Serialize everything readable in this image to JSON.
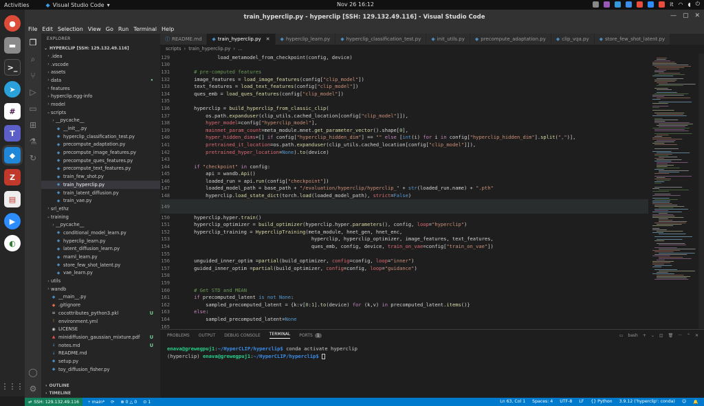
{
  "topbar": {
    "activities": "Activities",
    "app_name": "Visual Studio Code",
    "clock": "Nov 26  16:12",
    "lang": "it"
  },
  "window": {
    "title": "train_hyperclip.py - hyperclip [SSH: 129.132.49.116] - Visual Studio Code"
  },
  "menu": [
    "File",
    "Edit",
    "Selection",
    "View",
    "Go",
    "Run",
    "Terminal",
    "Help"
  ],
  "explorer": {
    "header": "EXPLORER",
    "project": "HYPERCLIP [SSH: 129.132.49.116]",
    "outline": "OUTLINE",
    "timeline": "TIMELINE",
    "items": [
      {
        "label": ".idea",
        "kind": "folder",
        "depth": 1
      },
      {
        "label": ".vscode",
        "kind": "folder",
        "depth": 1
      },
      {
        "label": "assets",
        "kind": "folder",
        "depth": 1
      },
      {
        "label": "data",
        "kind": "folder",
        "depth": 1,
        "badge": "•"
      },
      {
        "label": "features",
        "kind": "folder",
        "depth": 1
      },
      {
        "label": "hyperclip.egg-info",
        "kind": "folder",
        "depth": 1
      },
      {
        "label": "model",
        "kind": "folder",
        "depth": 1
      },
      {
        "label": "scripts",
        "kind": "folder-open",
        "depth": 1
      },
      {
        "label": "__pycache__",
        "kind": "folder",
        "depth": 2
      },
      {
        "label": "__init__.py",
        "kind": "py",
        "depth": 2
      },
      {
        "label": "hyperclip_classification_test.py",
        "kind": "py",
        "depth": 2
      },
      {
        "label": "precompute_adaptation.py",
        "kind": "py",
        "depth": 2
      },
      {
        "label": "precompute_image_features.py",
        "kind": "py",
        "depth": 2
      },
      {
        "label": "precompute_ques_features.py",
        "kind": "py",
        "depth": 2
      },
      {
        "label": "precompute_text_features.py",
        "kind": "py",
        "depth": 2
      },
      {
        "label": "train_few_shot.py",
        "kind": "py",
        "depth": 2
      },
      {
        "label": "train_hyperclip.py",
        "kind": "py",
        "depth": 2,
        "selected": true
      },
      {
        "label": "train_latent_diffusion.py",
        "kind": "py",
        "depth": 2
      },
      {
        "label": "train_vae.py",
        "kind": "py",
        "depth": 2
      },
      {
        "label": "srl_ethz",
        "kind": "folder",
        "depth": 1
      },
      {
        "label": "training",
        "kind": "folder-open",
        "depth": 1
      },
      {
        "label": "__pycache__",
        "kind": "folder",
        "depth": 2
      },
      {
        "label": "conditional_model_learn.py",
        "kind": "py",
        "depth": 2
      },
      {
        "label": "hyperclip_learn.py",
        "kind": "py",
        "depth": 2
      },
      {
        "label": "latent_diffusion_learn.py",
        "kind": "py",
        "depth": 2
      },
      {
        "label": "maml_learn.py",
        "kind": "py",
        "depth": 2
      },
      {
        "label": "store_few_shot_latent.py",
        "kind": "py",
        "depth": 2
      },
      {
        "label": "vae_learn.py",
        "kind": "py",
        "depth": 2
      },
      {
        "label": "utils",
        "kind": "folder",
        "depth": 1
      },
      {
        "label": "wandb",
        "kind": "folder",
        "depth": 1
      },
      {
        "label": "__main__.py",
        "kind": "py",
        "depth": 1
      },
      {
        "label": ".gitignore",
        "kind": "gi",
        "depth": 1
      },
      {
        "label": "cocottributes_python3.pkl",
        "kind": "file",
        "depth": 1,
        "badge": "U"
      },
      {
        "label": "environment.yml",
        "kind": "yml",
        "depth": 1
      },
      {
        "label": "LICENSE",
        "kind": "lic",
        "depth": 1
      },
      {
        "label": "minidiffusion_gaussian_mixture.pdf",
        "kind": "pdf",
        "depth": 1,
        "badge": "U"
      },
      {
        "label": "notes.md",
        "kind": "md",
        "depth": 1,
        "badge": "U"
      },
      {
        "label": "README.md",
        "kind": "md",
        "depth": 1
      },
      {
        "label": "setup.py",
        "kind": "py",
        "depth": 1
      },
      {
        "label": "toy_diffusion_fisher.py",
        "kind": "py",
        "depth": 1
      }
    ]
  },
  "tabs": [
    {
      "label": "README.md",
      "kind": "md"
    },
    {
      "label": "train_hyperclip.py",
      "kind": "py",
      "active": true
    },
    {
      "label": "hyperclip_learn.py",
      "kind": "py"
    },
    {
      "label": "hyperclip_classification_test.py",
      "kind": "py"
    },
    {
      "label": "init_utils.py",
      "kind": "py"
    },
    {
      "label": "precompute_adaptation.py",
      "kind": "py"
    },
    {
      "label": "clip_vqa.py",
      "kind": "py"
    },
    {
      "label": "store_few_shot_latent.py",
      "kind": "py"
    }
  ],
  "breadcrumb": [
    "scripts",
    "train_hyperclip.py",
    "..."
  ],
  "code": [
    {
      "n": "129",
      "html": "            load_metamodel_from_checkpoint(config, device)"
    },
    {
      "n": "130",
      "html": ""
    },
    {
      "n": "131",
      "html": "    <span class=\"cm\"># pre-computed features</span>"
    },
    {
      "n": "132",
      "html": "    image_features = <span class=\"fn\">load_image_features</span>(config[<span class=\"str\">\"clip_model\"</span>])"
    },
    {
      "n": "133",
      "html": "    text_features = <span class=\"fn\">load_text_features</span>(config[<span class=\"str\">\"clip_model\"</span>])"
    },
    {
      "n": "134",
      "html": "    ques_emb = <span class=\"fn\">load_ques_features</span>(config[<span class=\"str\">\"clip_model\"</span>])"
    },
    {
      "n": "135",
      "html": ""
    },
    {
      "n": "136",
      "html": "    hyperclip = <span class=\"fn\">build_hyperclip_from_classic_clip</span>("
    },
    {
      "n": "137",
      "html": "        os.path.<span class=\"fn\">expanduser</span>(clip_utils.cached_location[config[<span class=\"str\">\"clip_model\"</span>]]),"
    },
    {
      "n": "138",
      "html": "        <span class=\"prm\">hyper_model</span>=config[<span class=\"str\">\"hyperclip_model\"</span>],"
    },
    {
      "n": "139",
      "html": "        <span class=\"prm\">mainnet_param_count</span>=meta_module.mnet.<span class=\"fn\">get_parameter_vector</span>().shape[<span class=\"num\">0</span>],"
    },
    {
      "n": "140",
      "html": "        <span class=\"prm\">hyper_hidden_dims</span>=[] <span class=\"kw\">if</span> config[<span class=\"str\">\"hyperclip_hidden_dim\"</span>] == <span class=\"str\">\"\"</span> <span class=\"kw\">else</span> [<span class=\"bi\">int</span>(i) <span class=\"kw\">for</span> i <span class=\"kw\">in</span> config[<span class=\"str\">\"hyperclip_hidden_dim\"</span>].<span class=\"fn\">split</span>(<span class=\"str\">\",\"</span>)],"
    },
    {
      "n": "141",
      "html": "        <span class=\"prm\">pretrained_it_location</span>=os.path.<span class=\"fn\">expanduser</span>(clip_utils.cached_location[config[<span class=\"str\">\"clip_model\"</span>]]),"
    },
    {
      "n": "142",
      "html": "        <span class=\"prm\">pretrained_hyper_location</span>=<span class=\"bi\">None</span>).<span class=\"fn\">to</span>(device)"
    },
    {
      "n": "143",
      "html": ""
    },
    {
      "n": "144",
      "html": "    <span class=\"kw\">if</span> <span class=\"str\">\"checkpoint\"</span> <span class=\"kw\">in</span> config:"
    },
    {
      "n": "145",
      "html": "        api = wandb.<span class=\"fn\">Api</span>()"
    },
    {
      "n": "146",
      "html": "        loaded_run = api.<span class=\"fn\">run</span>(config[<span class=\"str\">\"checkpoint\"</span>])"
    },
    {
      "n": "147",
      "html": "        loaded_model_path = base_path + <span class=\"str\">\"/evaluation/hyperclip/hyperclip_\"</span> + <span class=\"bi\">str</span>(loaded_run.name) + <span class=\"str\">\".pth\"</span>"
    },
    {
      "n": "148",
      "html": "        hyperclip.<span class=\"fn\">load_state_dict</span>(torch.<span class=\"fn\">load</span>(loaded_model_path), <span class=\"prm\">strict</span>=<span class=\"bi\">False</span>)"
    },
    {
      "n": "149",
      "html": "",
      "hl": true
    },
    {
      "n": "150",
      "html": "    hyperclip.hyper.<span class=\"fn\">train</span>()"
    },
    {
      "n": "151",
      "html": "    hyperclip_optimizer = <span class=\"fn\">build_optimizer</span>(hyperclip.hyper.<span class=\"fn\">parameters</span>(), config, <span class=\"prm\">loop</span>=<span class=\"str\">\"hyperclip\"</span>)"
    },
    {
      "n": "152",
      "html": "    hyperclip_training = <span class=\"fn\">HyperclipTraining</span>(meta_module, hnet_gen, hnet_enc,"
    },
    {
      "n": "153",
      "html": "                                            hyperclip, hyperclip_optimizer, image_features, text_features,"
    },
    {
      "n": "154",
      "html": "                                            ques_emb, config, device, <span class=\"prm\">train_on_vae</span>=config[<span class=\"str\">\"train_on_vae\"</span>])"
    },
    {
      "n": "155",
      "html": ""
    },
    {
      "n": "156",
      "html": "    unguided_inner_optim =<span class=\"fn\">partial</span>(build_optimizer, <span class=\"prm\">config</span>=config, <span class=\"prm\">loop</span>=<span class=\"str\">\"inner\"</span>)"
    },
    {
      "n": "157",
      "html": "    guided_inner_optim =<span class=\"fn\">partial</span>(build_optimizer, <span class=\"prm\">config</span>=config, <span class=\"prm\">loop</span>=<span class=\"str\">\"guidance\"</span>)"
    },
    {
      "n": "158",
      "html": ""
    },
    {
      "n": "159",
      "html": ""
    },
    {
      "n": "160",
      "html": "    <span class=\"cm\"># Get STD and MEAN</span>"
    },
    {
      "n": "161",
      "html": "    <span class=\"kw\">if</span> precomputed_latent <span class=\"bi\">is not None</span>:"
    },
    {
      "n": "162",
      "html": "        sampled_precomputed_latent = {k:v[<span class=\"num\">0</span>:<span class=\"num\">1</span>].<span class=\"fn\">to</span>(device) <span class=\"kw\">for</span> (k,v) <span class=\"kw\">in</span> precomputed_latent.<span class=\"fn\">items</span>()}"
    },
    {
      "n": "163",
      "html": "    <span class=\"kw\">else</span>:"
    },
    {
      "n": "164",
      "html": "        sampled_precomputed_latent=<span class=\"bi\">None</span>"
    },
    {
      "n": "165",
      "html": ""
    }
  ],
  "panel": {
    "tabs": [
      "PROBLEMS",
      "OUTPUT",
      "DEBUG CONSOLE",
      "TERMINAL",
      "PORTS"
    ],
    "ports_count": "1",
    "shell": "bash",
    "lines": [
      {
        "prompt": "enava@grewegpuj1:~/HyperCLIP/hyperclip$",
        "cmd": " conda activate hyperclip",
        "prefix": ""
      },
      {
        "prompt": "enava@grewegpuj1:~/HyperCLIP/hyperclip$",
        "cmd": " ",
        "prefix": "(hyperclip) "
      }
    ]
  },
  "status": {
    "ssh": "SSH: 129.132.49.116",
    "branch": "main*",
    "sync": "⟳",
    "errors": "0",
    "warnings": "0",
    "ports": "1",
    "position": "Ln 63, Col 1",
    "spaces": "Spaces: 4",
    "encoding": "UTF-8",
    "eol": "LF",
    "language": "Python",
    "interpreter": "3.9.12 ('hyperclip': conda)"
  }
}
